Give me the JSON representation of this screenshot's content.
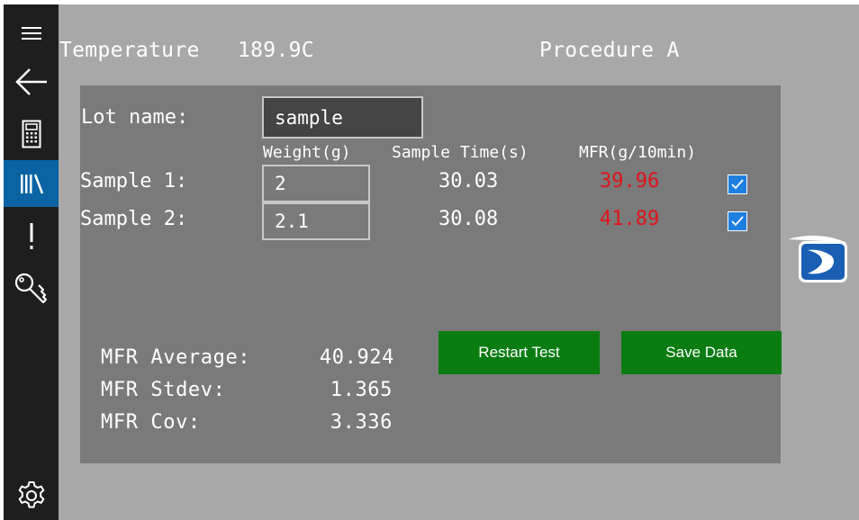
{
  "header": {
    "temperature_label": "Temperature",
    "temperature_value": "189.9C",
    "procedure": "Procedure A"
  },
  "sidebar": {
    "items": [
      {
        "icon": "hamburger-menu-icon"
      },
      {
        "icon": "back-arrow-icon"
      },
      {
        "icon": "calculator-icon"
      },
      {
        "icon": "library-icon",
        "active": true
      },
      {
        "icon": "exclamation-icon"
      },
      {
        "icon": "key-icon"
      },
      {
        "icon": "gear-icon"
      }
    ]
  },
  "form": {
    "lot_label": "Lot name:",
    "lot_value": "sample",
    "columns": [
      "Weight(g)",
      "Sample Time(s)",
      "MFR(g/10min)"
    ],
    "samples": [
      {
        "label": "Sample 1:",
        "weight": "2",
        "time": "30.03",
        "mfr": "39.96",
        "checked": true
      },
      {
        "label": "Sample 2:",
        "weight": "2.1",
        "time": "30.08",
        "mfr": "41.89",
        "checked": true
      }
    ]
  },
  "stats": {
    "average_label": "MFR Average:",
    "average_value": "40.924",
    "stdev_label": "MFR Stdev:",
    "stdev_value": "1.365",
    "cov_label": "MFR Cov:",
    "cov_value": "3.336"
  },
  "buttons": {
    "restart": "Restart Test",
    "save": "Save Data"
  },
  "colors": {
    "accent_blue": "#0a64a4",
    "mfr_red": "#e0131a",
    "button_green": "#0a7c12",
    "checkbox_blue": "#1c7fe0"
  }
}
